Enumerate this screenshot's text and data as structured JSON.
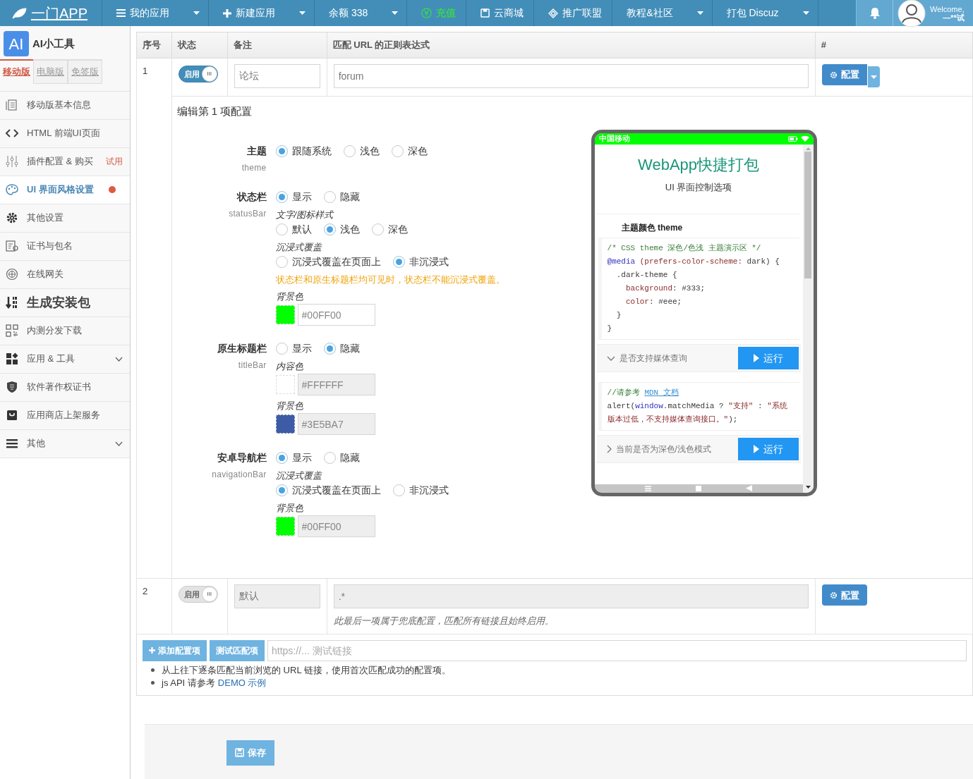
{
  "navbar": {
    "brand": "一门APP",
    "items": [
      {
        "label": "我的应用",
        "caret": true,
        "highlight": false
      },
      {
        "label": "新建应用",
        "caret": true,
        "highlight": false
      },
      {
        "label": "余额 338",
        "caret": true,
        "highlight": false
      },
      {
        "label": "充值",
        "caret": false,
        "highlight": true
      },
      {
        "label": "云商城",
        "caret": false,
        "highlight": false
      },
      {
        "label": "推广联盟",
        "caret": false,
        "highlight": false
      },
      {
        "label": "教程&社区",
        "caret": true,
        "highlight": false
      },
      {
        "label": "打包 Discuz",
        "caret": true,
        "highlight": false
      }
    ],
    "user": {
      "greeting": "Welcome,",
      "name": "—**试"
    }
  },
  "sidebar": {
    "logo": "AI",
    "app_name": "AI小工具",
    "tabs": [
      {
        "label": "移动版",
        "selected": true
      },
      {
        "label": "电脑版",
        "selected": false
      },
      {
        "label": "免签版",
        "selected": false
      }
    ],
    "items": [
      {
        "label": "移动版基本信息",
        "kind": "normal",
        "selected": false,
        "alert": false,
        "expandable": false
      },
      {
        "label": "HTML 前端UI页面",
        "kind": "normal",
        "selected": false,
        "alert": false,
        "expandable": false
      },
      {
        "label": "插件配置 & 购买",
        "kind": "normal",
        "badge": "试用",
        "selected": false,
        "alert": false,
        "expandable": false
      },
      {
        "label": "UI 界面风格设置",
        "kind": "normal",
        "selected": true,
        "alert": true,
        "expandable": false
      },
      {
        "label": "其他设置",
        "kind": "normal",
        "selected": false,
        "alert": false,
        "expandable": false
      },
      {
        "label": "证书与包名",
        "kind": "normal",
        "selected": false,
        "alert": false,
        "expandable": false
      },
      {
        "label": "在线网关",
        "kind": "normal",
        "selected": false,
        "alert": false,
        "expandable": false
      },
      {
        "label": "生成安装包",
        "kind": "large",
        "selected": false,
        "alert": false,
        "expandable": false
      },
      {
        "label": "内测分发下载",
        "kind": "normal",
        "selected": false,
        "alert": false,
        "expandable": false
      },
      {
        "label": "应用 & 工具",
        "kind": "normal",
        "selected": false,
        "alert": false,
        "expandable": true
      },
      {
        "label": "软件著作权证书",
        "kind": "normal",
        "selected": false,
        "alert": false,
        "expandable": false
      },
      {
        "label": "应用商店上架服务",
        "kind": "normal",
        "selected": false,
        "alert": false,
        "expandable": false
      },
      {
        "label": "其他",
        "kind": "normal",
        "selected": false,
        "alert": false,
        "expandable": true
      }
    ]
  },
  "table": {
    "columns": [
      "序号",
      "状态",
      "备注",
      "匹配 URL 的正则表达式",
      "#"
    ],
    "rows": [
      {
        "index": "1",
        "toggle": {
          "label": "启用",
          "knob": "III",
          "on": true
        },
        "disabled": false,
        "note": "论坛",
        "pattern": "forum",
        "button": "配置",
        "split": true
      },
      {
        "index": "2",
        "toggle": {
          "label": "启用",
          "knob": "III",
          "on": true
        },
        "disabled": true,
        "note": "默认",
        "pattern": ".*",
        "hint": "此最后一项属于兜底配置，匹配所有链接且始终启用。",
        "button": "配置",
        "split": false
      }
    ]
  },
  "editor": {
    "title": "编辑第 1 项配置",
    "sections": [
      {
        "title": "主题",
        "subtitle": "theme",
        "options": [
          {
            "label": "跟随系统",
            "selected": true
          },
          {
            "label": "浅色",
            "selected": false
          },
          {
            "label": "深色",
            "selected": false
          }
        ]
      },
      {
        "title": "状态栏",
        "subtitle": "statusBar",
        "options": [
          {
            "label": "显示",
            "selected": true
          },
          {
            "label": "隐藏",
            "selected": false
          }
        ],
        "groups": [
          {
            "kind": "radio",
            "label": "文字/图标样式",
            "options": [
              {
                "label": "默认",
                "selected": false
              },
              {
                "label": "浅色",
                "selected": true
              },
              {
                "label": "深色",
                "selected": false
              }
            ]
          },
          {
            "kind": "radio",
            "label": "沉浸式覆盖",
            "options": [
              {
                "label": "沉浸式覆盖在页面上",
                "selected": false
              },
              {
                "label": "非沉浸式",
                "selected": true
              }
            ]
          },
          {
            "kind": "warning",
            "text": "状态栏和原生标题栏均可见时，状态栏不能沉浸式覆盖。"
          },
          {
            "kind": "color",
            "label": "背景色",
            "value": "#00FF00",
            "color": "#00ff00",
            "disabled": false
          }
        ]
      },
      {
        "title": "原生标题栏",
        "subtitle": "titleBar",
        "options": [
          {
            "label": "显示",
            "selected": false
          },
          {
            "label": "隐藏",
            "selected": true
          }
        ],
        "groups": [
          {
            "kind": "color",
            "label": "内容色",
            "value": "#FFFFFF",
            "color": "#ffffff",
            "disabled": true
          },
          {
            "kind": "color",
            "label": "背景色",
            "value": "#3E5BA7",
            "color": "#3e5ba7",
            "disabled": true
          }
        ]
      },
      {
        "title": "安卓导航栏",
        "subtitle": "navigationBar",
        "options": [
          {
            "label": "显示",
            "selected": true
          },
          {
            "label": "隐藏",
            "selected": false
          }
        ],
        "groups": [
          {
            "kind": "radio",
            "label": "沉浸式覆盖",
            "options": [
              {
                "label": "沉浸式覆盖在页面上",
                "selected": true
              },
              {
                "label": "非沉浸式",
                "selected": false
              }
            ]
          },
          {
            "kind": "color",
            "label": "背景色",
            "value": "#00FF00",
            "color": "#00ff00",
            "disabled": true
          }
        ]
      }
    ]
  },
  "phone": {
    "status_bar": {
      "carrier": "中国移动",
      "color": "#00ff00"
    },
    "title": "WebApp快捷打包",
    "subtitle": "UI 界面控制选项",
    "section": "主题颜色 theme",
    "blocks": [
      {
        "kind": "code",
        "lines": [
          [
            {
              "kind": "comment",
              "text": "/* CSS theme 深色/色浅 主题演示区 */"
            }
          ],
          [
            {
              "kind": "keyword",
              "text": "@media"
            },
            {
              "kind": "prop",
              "text": " (prefers-color-scheme:"
            },
            {
              "kind": "plain",
              "text": " dark) {"
            }
          ],
          [
            {
              "kind": "plain",
              "text": "  .dark-theme {"
            }
          ],
          [
            {
              "kind": "prop",
              "text": "    background"
            },
            {
              "kind": "plain",
              "text": ": #333;"
            }
          ],
          [
            {
              "kind": "prop",
              "text": "    color"
            },
            {
              "kind": "plain",
              "text": ": #eee;"
            }
          ],
          [
            {
              "kind": "plain",
              "text": "  }"
            }
          ],
          [
            {
              "kind": "plain",
              "text": "}"
            }
          ]
        ]
      },
      {
        "kind": "run",
        "label": "是否支持媒体查询",
        "expanded": true,
        "button": "运行"
      },
      {
        "kind": "code",
        "lines": [
          [
            {
              "kind": "comment",
              "text": "//请参考 "
            },
            {
              "kind": "link",
              "text": "MDN 文档"
            }
          ],
          [
            {
              "kind": "plain",
              "text": "alert("
            },
            {
              "kind": "keyword",
              "text": "window"
            },
            {
              "kind": "plain",
              "text": ".matchMedia ? "
            },
            {
              "kind": "string",
              "text": "\"支持\""
            },
            {
              "kind": "plain",
              "text": " : "
            },
            {
              "kind": "string",
              "text": "\"系统版本过低，不支持媒体查询接口。\""
            },
            {
              "kind": "plain",
              "text": ");"
            }
          ]
        ]
      },
      {
        "kind": "run",
        "label": "当前是否为深色/浅色模式",
        "expanded": false,
        "button": "运行"
      }
    ]
  },
  "footer": {
    "add_button": "添加配置项",
    "test_button": "测试匹配项",
    "test_placeholder": "https://... 测试链接",
    "notes": [
      {
        "text": "从上往下逐条匹配当前浏览的 URL 链接，使用首次匹配成功的配置项。"
      },
      {
        "text": "js API 请参考",
        "link": "DEMO 示例"
      }
    ],
    "save_button": "保存"
  }
}
